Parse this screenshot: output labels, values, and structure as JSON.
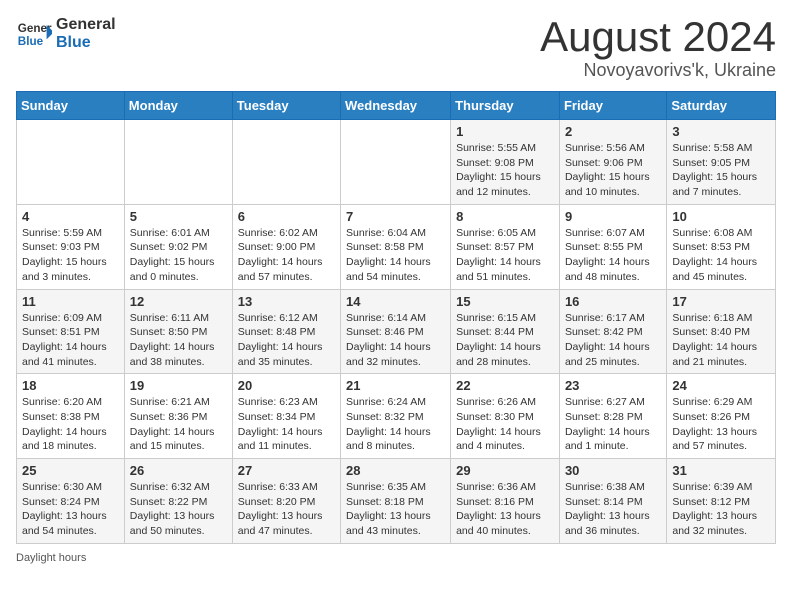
{
  "header": {
    "logo": {
      "general": "General",
      "blue": "Blue"
    },
    "title": "August 2024",
    "location": "Novoyavorivs'k, Ukraine"
  },
  "calendar": {
    "weekdays": [
      "Sunday",
      "Monday",
      "Tuesday",
      "Wednesday",
      "Thursday",
      "Friday",
      "Saturday"
    ],
    "weeks": [
      [
        {
          "day": "",
          "sunrise": "",
          "sunset": "",
          "daylight": ""
        },
        {
          "day": "",
          "sunrise": "",
          "sunset": "",
          "daylight": ""
        },
        {
          "day": "",
          "sunrise": "",
          "sunset": "",
          "daylight": ""
        },
        {
          "day": "",
          "sunrise": "",
          "sunset": "",
          "daylight": ""
        },
        {
          "day": "1",
          "sunrise": "Sunrise: 5:55 AM",
          "sunset": "Sunset: 9:08 PM",
          "daylight": "Daylight: 15 hours and 12 minutes."
        },
        {
          "day": "2",
          "sunrise": "Sunrise: 5:56 AM",
          "sunset": "Sunset: 9:06 PM",
          "daylight": "Daylight: 15 hours and 10 minutes."
        },
        {
          "day": "3",
          "sunrise": "Sunrise: 5:58 AM",
          "sunset": "Sunset: 9:05 PM",
          "daylight": "Daylight: 15 hours and 7 minutes."
        }
      ],
      [
        {
          "day": "4",
          "sunrise": "Sunrise: 5:59 AM",
          "sunset": "Sunset: 9:03 PM",
          "daylight": "Daylight: 15 hours and 3 minutes."
        },
        {
          "day": "5",
          "sunrise": "Sunrise: 6:01 AM",
          "sunset": "Sunset: 9:02 PM",
          "daylight": "Daylight: 15 hours and 0 minutes."
        },
        {
          "day": "6",
          "sunrise": "Sunrise: 6:02 AM",
          "sunset": "Sunset: 9:00 PM",
          "daylight": "Daylight: 14 hours and 57 minutes."
        },
        {
          "day": "7",
          "sunrise": "Sunrise: 6:04 AM",
          "sunset": "Sunset: 8:58 PM",
          "daylight": "Daylight: 14 hours and 54 minutes."
        },
        {
          "day": "8",
          "sunrise": "Sunrise: 6:05 AM",
          "sunset": "Sunset: 8:57 PM",
          "daylight": "Daylight: 14 hours and 51 minutes."
        },
        {
          "day": "9",
          "sunrise": "Sunrise: 6:07 AM",
          "sunset": "Sunset: 8:55 PM",
          "daylight": "Daylight: 14 hours and 48 minutes."
        },
        {
          "day": "10",
          "sunrise": "Sunrise: 6:08 AM",
          "sunset": "Sunset: 8:53 PM",
          "daylight": "Daylight: 14 hours and 45 minutes."
        }
      ],
      [
        {
          "day": "11",
          "sunrise": "Sunrise: 6:09 AM",
          "sunset": "Sunset: 8:51 PM",
          "daylight": "Daylight: 14 hours and 41 minutes."
        },
        {
          "day": "12",
          "sunrise": "Sunrise: 6:11 AM",
          "sunset": "Sunset: 8:50 PM",
          "daylight": "Daylight: 14 hours and 38 minutes."
        },
        {
          "day": "13",
          "sunrise": "Sunrise: 6:12 AM",
          "sunset": "Sunset: 8:48 PM",
          "daylight": "Daylight: 14 hours and 35 minutes."
        },
        {
          "day": "14",
          "sunrise": "Sunrise: 6:14 AM",
          "sunset": "Sunset: 8:46 PM",
          "daylight": "Daylight: 14 hours and 32 minutes."
        },
        {
          "day": "15",
          "sunrise": "Sunrise: 6:15 AM",
          "sunset": "Sunset: 8:44 PM",
          "daylight": "Daylight: 14 hours and 28 minutes."
        },
        {
          "day": "16",
          "sunrise": "Sunrise: 6:17 AM",
          "sunset": "Sunset: 8:42 PM",
          "daylight": "Daylight: 14 hours and 25 minutes."
        },
        {
          "day": "17",
          "sunrise": "Sunrise: 6:18 AM",
          "sunset": "Sunset: 8:40 PM",
          "daylight": "Daylight: 14 hours and 21 minutes."
        }
      ],
      [
        {
          "day": "18",
          "sunrise": "Sunrise: 6:20 AM",
          "sunset": "Sunset: 8:38 PM",
          "daylight": "Daylight: 14 hours and 18 minutes."
        },
        {
          "day": "19",
          "sunrise": "Sunrise: 6:21 AM",
          "sunset": "Sunset: 8:36 PM",
          "daylight": "Daylight: 14 hours and 15 minutes."
        },
        {
          "day": "20",
          "sunrise": "Sunrise: 6:23 AM",
          "sunset": "Sunset: 8:34 PM",
          "daylight": "Daylight: 14 hours and 11 minutes."
        },
        {
          "day": "21",
          "sunrise": "Sunrise: 6:24 AM",
          "sunset": "Sunset: 8:32 PM",
          "daylight": "Daylight: 14 hours and 8 minutes."
        },
        {
          "day": "22",
          "sunrise": "Sunrise: 6:26 AM",
          "sunset": "Sunset: 8:30 PM",
          "daylight": "Daylight: 14 hours and 4 minutes."
        },
        {
          "day": "23",
          "sunrise": "Sunrise: 6:27 AM",
          "sunset": "Sunset: 8:28 PM",
          "daylight": "Daylight: 14 hours and 1 minute."
        },
        {
          "day": "24",
          "sunrise": "Sunrise: 6:29 AM",
          "sunset": "Sunset: 8:26 PM",
          "daylight": "Daylight: 13 hours and 57 minutes."
        }
      ],
      [
        {
          "day": "25",
          "sunrise": "Sunrise: 6:30 AM",
          "sunset": "Sunset: 8:24 PM",
          "daylight": "Daylight: 13 hours and 54 minutes."
        },
        {
          "day": "26",
          "sunrise": "Sunrise: 6:32 AM",
          "sunset": "Sunset: 8:22 PM",
          "daylight": "Daylight: 13 hours and 50 minutes."
        },
        {
          "day": "27",
          "sunrise": "Sunrise: 6:33 AM",
          "sunset": "Sunset: 8:20 PM",
          "daylight": "Daylight: 13 hours and 47 minutes."
        },
        {
          "day": "28",
          "sunrise": "Sunrise: 6:35 AM",
          "sunset": "Sunset: 8:18 PM",
          "daylight": "Daylight: 13 hours and 43 minutes."
        },
        {
          "day": "29",
          "sunrise": "Sunrise: 6:36 AM",
          "sunset": "Sunset: 8:16 PM",
          "daylight": "Daylight: 13 hours and 40 minutes."
        },
        {
          "day": "30",
          "sunrise": "Sunrise: 6:38 AM",
          "sunset": "Sunset: 8:14 PM",
          "daylight": "Daylight: 13 hours and 36 minutes."
        },
        {
          "day": "31",
          "sunrise": "Sunrise: 6:39 AM",
          "sunset": "Sunset: 8:12 PM",
          "daylight": "Daylight: 13 hours and 32 minutes."
        }
      ]
    ]
  },
  "footer": {
    "daylight_label": "Daylight hours"
  }
}
